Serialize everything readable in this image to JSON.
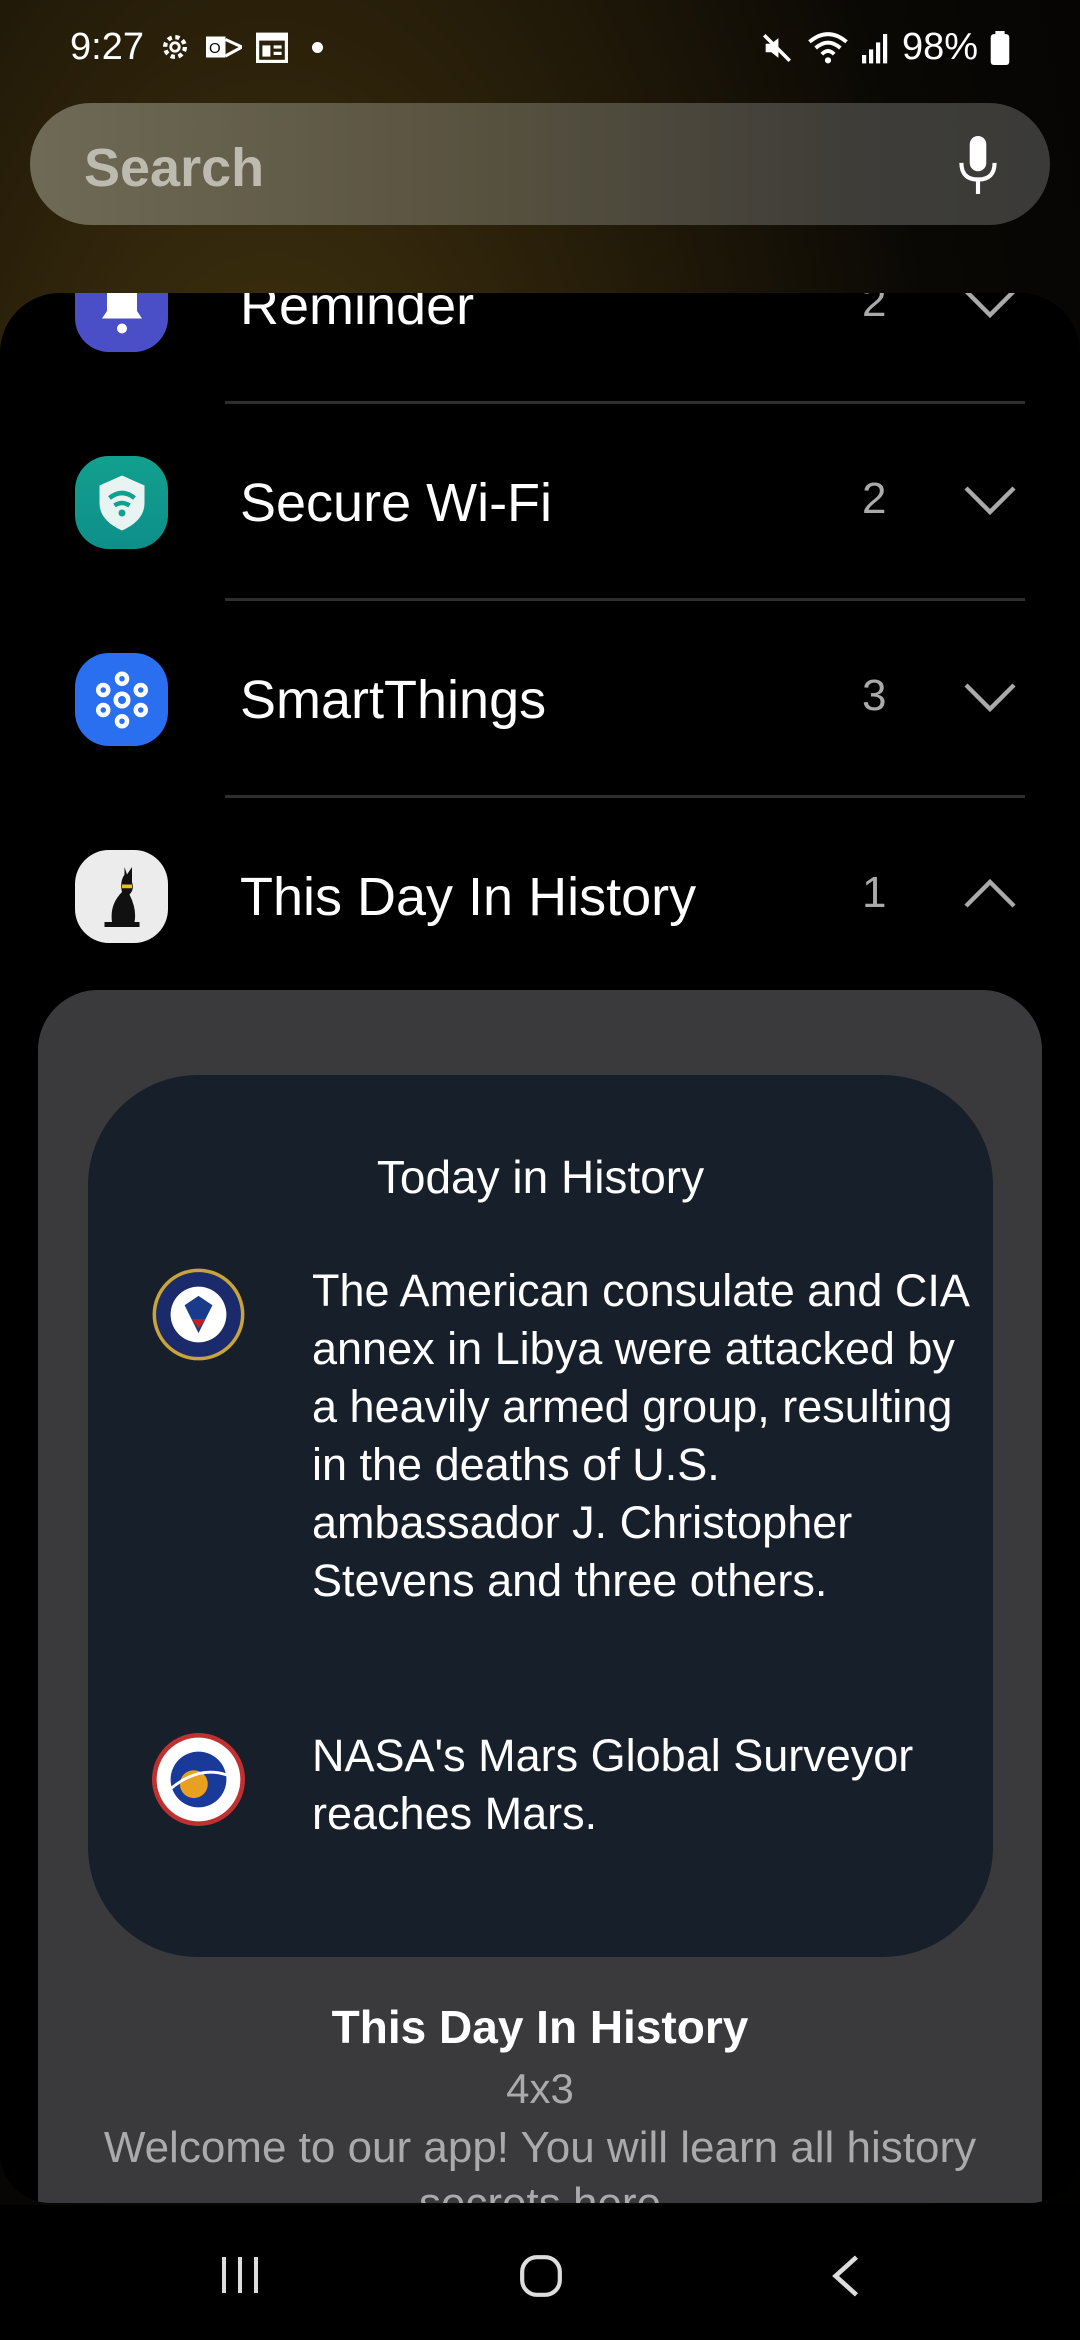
{
  "status": {
    "time": "9:27",
    "battery": "98%"
  },
  "search": {
    "placeholder": "Search"
  },
  "rows": [
    {
      "label": "Reminder",
      "count": "2",
      "expanded": false,
      "color": "#4a4fc8"
    },
    {
      "label": "Secure Wi-Fi",
      "count": "2",
      "expanded": false,
      "color": "#12a08e"
    },
    {
      "label": "SmartThings",
      "count": "3",
      "expanded": false,
      "color": "#2a6ff0"
    },
    {
      "label": "This Day In History",
      "count": "1",
      "expanded": true,
      "color": "#ececec"
    }
  ],
  "widget": {
    "title": "Today in History",
    "events": [
      {
        "text": "The American consulate and CIA annex in Libya were attacked by a heavily armed group, resulting in the deaths of U.S. ambassador J. Christopher Stevens and three others.",
        "logo": "CIA"
      },
      {
        "text": "NASA's Mars Global Surveyor reaches Mars.",
        "logo": "NASA"
      }
    ],
    "name": "This Day In History",
    "size": "4x3",
    "description": "Welcome to our app! You will learn all history secrets here"
  }
}
